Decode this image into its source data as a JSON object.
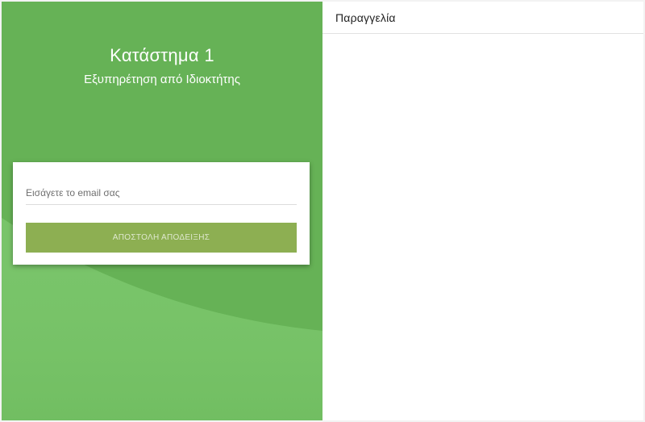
{
  "store": {
    "name": "Κατάστημα 1",
    "subtitle": "Εξυπηρέτηση από Ιδιοκτήτης"
  },
  "receipt_form": {
    "email_placeholder": "Εισάγετε το email σας",
    "email_value": "",
    "send_button_label": "ΑΠΟΣΤΟΛΗ ΑΠΟΔΕΙΞΗΣ",
    "send_button_enabled": false
  },
  "order_panel": {
    "title": "Παραγγελία",
    "items": []
  },
  "colors": {
    "page_background": "#f3f3f3",
    "green_primary": "#66b256",
    "green_light": "#79c46a",
    "button_disabled": "#8daf52",
    "card": "#ffffff"
  }
}
